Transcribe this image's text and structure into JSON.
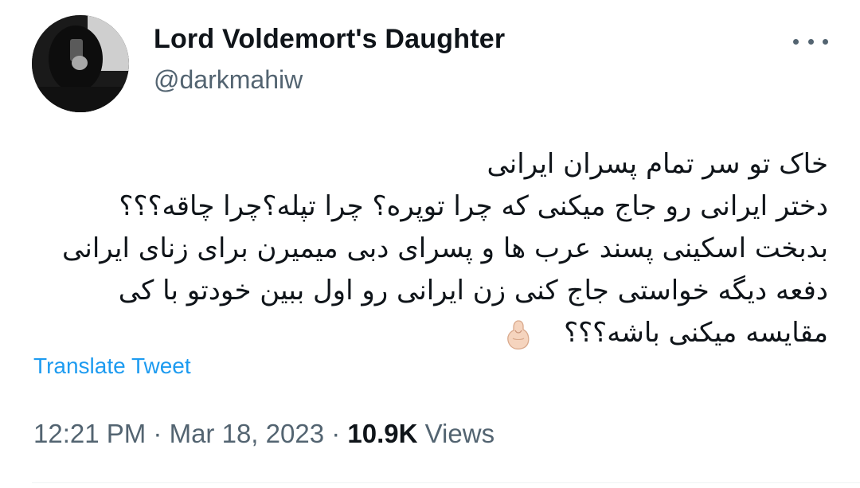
{
  "tweet": {
    "display_name": "Lord Voldemort's Daughter",
    "handle": "@darkmahiw",
    "text_lines": [
      "خاک تو سر تمام پسران ایرانی",
      "دختر ایرانی رو جاج میکنی که چرا توپره؟ چرا تپله؟چرا چاقه؟؟؟",
      "بدبخت اسکینی پسند عرب ها و پسرای دبی میمیرن برای زنای ایرانی",
      "دفعه دیگه خواستی جاج کنی زن ایرانی رو اول ببین خودتو با کی",
      "مقایسه میکنی باشه؟؟؟"
    ],
    "emoji_icon": "pinched-fingers-icon",
    "translate_label": "Translate Tweet",
    "time": "12:21 PM",
    "separator": "·",
    "date": "Mar 18, 2023",
    "views_count": "10.9K",
    "views_label": "Views"
  },
  "colors": {
    "text_primary": "#0f1419",
    "text_secondary": "#536471",
    "link": "#1d9bf0",
    "divider": "#eff3f4"
  }
}
